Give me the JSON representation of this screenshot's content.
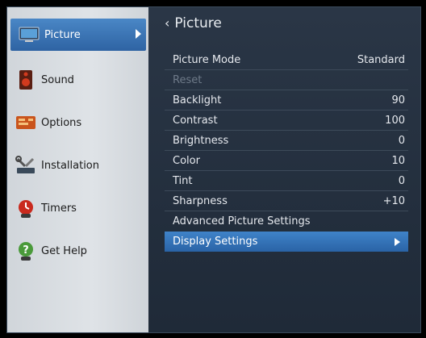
{
  "sidebar": {
    "items": [
      {
        "label": "Picture",
        "icon": "tv-icon"
      },
      {
        "label": "Sound",
        "icon": "speaker-icon"
      },
      {
        "label": "Options",
        "icon": "options-icon"
      },
      {
        "label": "Installation",
        "icon": "installation-icon"
      },
      {
        "label": "Timers",
        "icon": "timer-icon"
      },
      {
        "label": "Get Help",
        "icon": "help-icon"
      }
    ]
  },
  "main": {
    "title": "Picture",
    "rows": [
      {
        "label": "Picture Mode",
        "value": "Standard"
      },
      {
        "label": "Reset",
        "value": ""
      },
      {
        "label": "Backlight",
        "value": "90"
      },
      {
        "label": "Contrast",
        "value": "100"
      },
      {
        "label": "Brightness",
        "value": "0"
      },
      {
        "label": "Color",
        "value": "10"
      },
      {
        "label": "Tint",
        "value": "0"
      },
      {
        "label": "Sharpness",
        "value": "+10"
      },
      {
        "label": "Advanced Picture Settings",
        "value": ""
      },
      {
        "label": "Display Settings",
        "value": ""
      }
    ]
  },
  "colors": {
    "accent": "#2e63a3",
    "panel": "#1f2a38",
    "sidebar": "#dfe3e7"
  }
}
